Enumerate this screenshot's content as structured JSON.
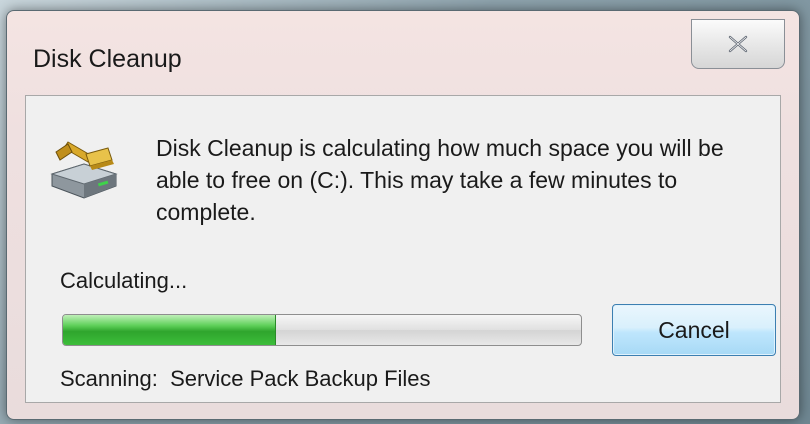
{
  "window": {
    "title": "Disk Cleanup",
    "close_icon": "close-x-icon"
  },
  "dialog": {
    "icon": "disk-cleanup-brush-icon",
    "message": "Disk Cleanup is calculating how much space you will be able to free on  (C:). This may take a few minutes to complete.",
    "status_label": "Calculating...",
    "progress_percent": 41,
    "cancel_label": "Cancel",
    "scanning_prefix": "Scanning:",
    "scanning_item": "Service Pack Backup Files"
  },
  "colors": {
    "progress_fill": "#3cbe3a",
    "button_border": "#3c7fb1"
  }
}
